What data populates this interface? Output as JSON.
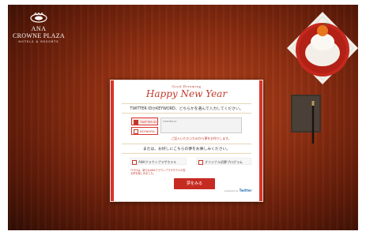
{
  "brand": {
    "line1": "ANA",
    "line2": "CROWNE PLAZA",
    "line3": "HOTELS & RESORTS"
  },
  "card": {
    "eyebrow": "Good Dreaming",
    "headline": "Happy New Year",
    "instruction_top": "TWITTER IDかKEYWORD、どちらかを選んで入力してください。",
    "tab_twitter": "TWITTER ID",
    "tab_keyword": "KEYWORD",
    "textbox_placeholder": "TWITTER ID",
    "note_red": "ご記入いただいたIDから夢をお作りします。",
    "instruction_mid": "または、お好しにこちらの夢をお楽しみください。",
    "option_left": "ANAクラウンプラザホテル",
    "option_right": "オリジナル初夢プログラム",
    "option_note": "TOTOは、新たなANAクラウンプラザホテルの在る夢を楽しみました。",
    "cta_label": "夢をみる",
    "powered_prefix": "powered by",
    "powered_brand": "Twitter"
  },
  "colors": {
    "accent": "#c62b22",
    "desk": "#8f2f12",
    "card": "#ffffff"
  }
}
